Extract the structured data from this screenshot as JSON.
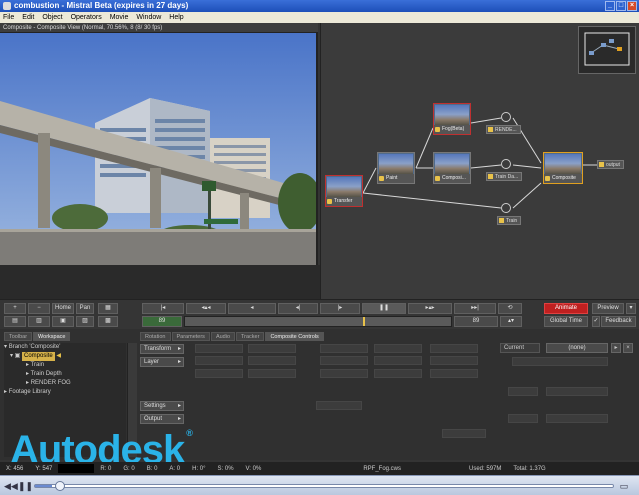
{
  "window": {
    "title": "combustion - Mistral Beta (expires in 27 days)"
  },
  "menu": [
    "File",
    "Edit",
    "Object",
    "Operators",
    "Movie",
    "Window",
    "Help"
  ],
  "viewer": {
    "header": "Composite - Composite View (Normal, 70.56%, 8 (8/ 30 fps)"
  },
  "flow": {
    "nodes": {
      "fog": "Fog(Beta)",
      "paint": "Paint",
      "composite_mid": "Composi...",
      "composite_main": "Composite",
      "footage": "Transfer",
      "render": "RENDE...",
      "train_depth": "Train Da...",
      "train": "Train",
      "output": "output"
    }
  },
  "transport": {
    "left_buttons": [
      "+",
      "−",
      "Home",
      "Pan"
    ],
    "frame_start": "89",
    "frame_end": "89",
    "animate_label": "Animate",
    "preview_label": "Preview",
    "global_time_label": "Global Time",
    "feedback_label": "Feedback"
  },
  "lower": {
    "left_tabs": [
      "Toolbar",
      "Workspace"
    ],
    "right_tabs": [
      "Rotation",
      "Parameters",
      "Audio",
      "Tracker",
      "Composite Controls"
    ],
    "tree": {
      "branch": "Branch 'Composite'",
      "composite": "Composite",
      "train": "Train",
      "train_depth": "Train Depth",
      "render_fog": "RENDER FOG",
      "footage_library": "Footage Library"
    },
    "controls": {
      "transform": "Transform",
      "layer": "Layer",
      "settings": "Settings",
      "output": "Output"
    },
    "current_label": "Current",
    "current_value": "(none)"
  },
  "watermark": "Autodesk",
  "status": {
    "x": "X: 456",
    "y": "Y: 547",
    "r": "R: 0",
    "g": "G: 0",
    "b": "B: 0",
    "a": "A: 0",
    "h": "H: 0°",
    "s": "S: 0%",
    "v": "V: 0%",
    "file": "RPF_Fog.cws",
    "used": "Used: 597M",
    "total": "Total: 1.37G"
  },
  "player": {
    "progress": 0.03
  }
}
